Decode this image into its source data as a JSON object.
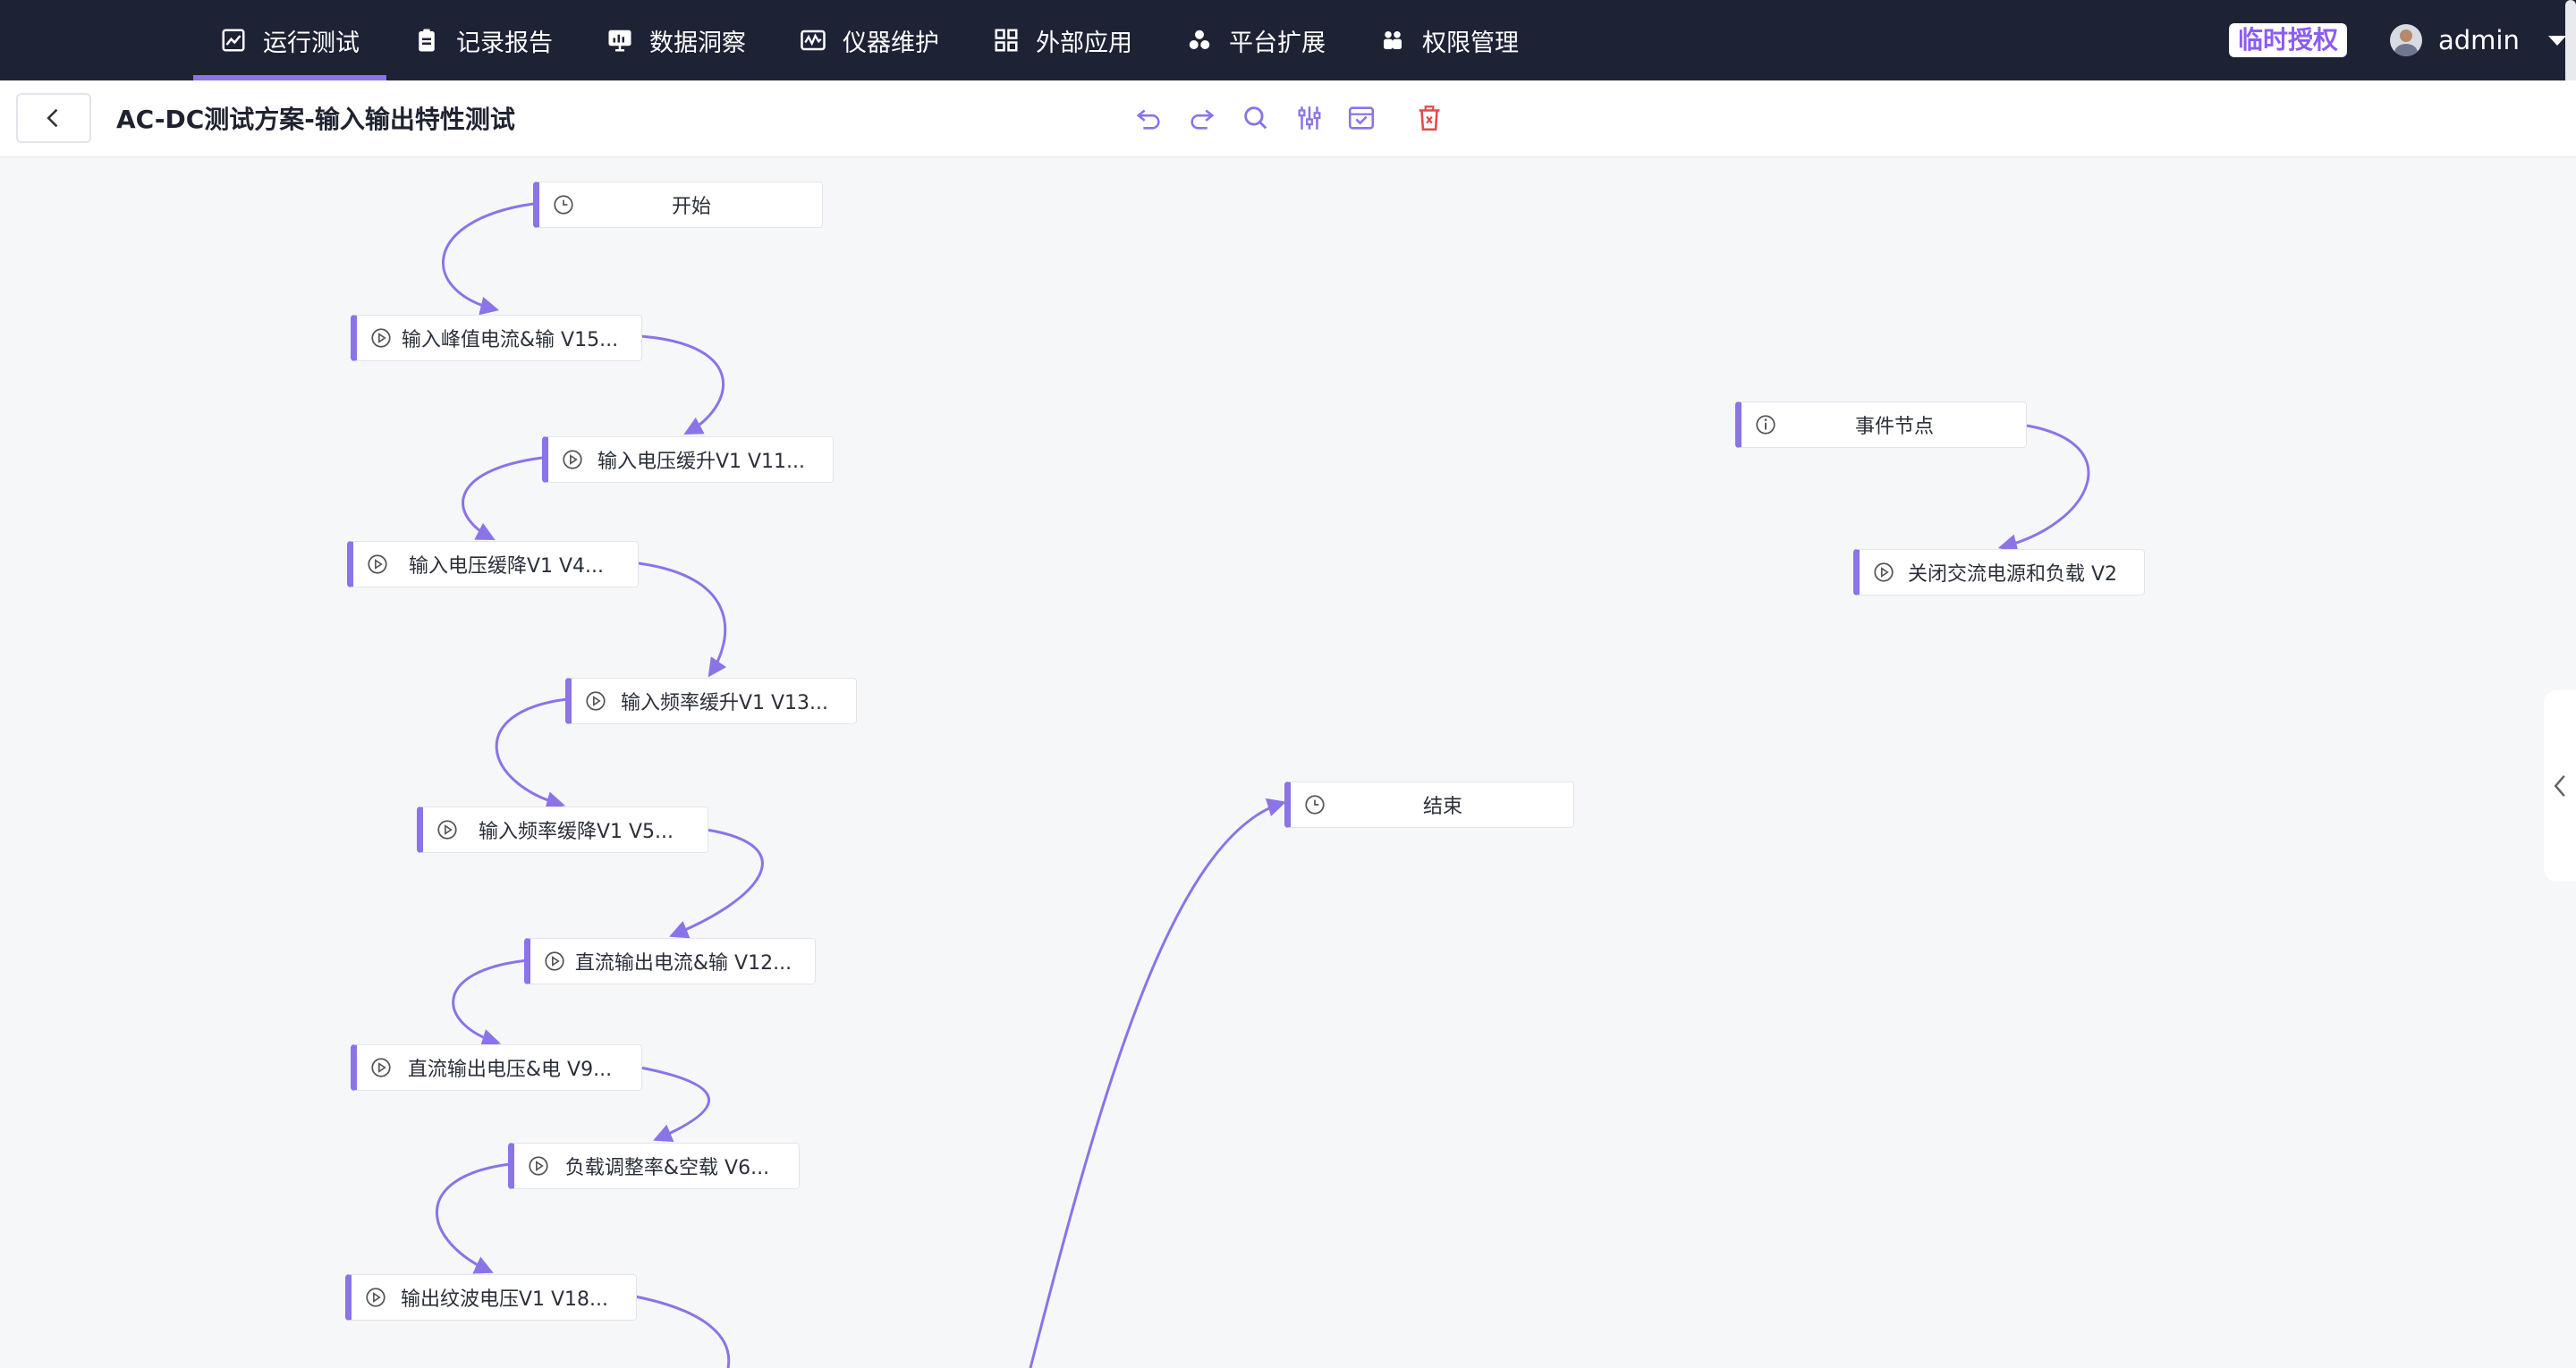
{
  "nav": {
    "items": [
      {
        "label": "运行测试",
        "icon": "chart-icon",
        "active": true
      },
      {
        "label": "记录报告",
        "icon": "clipboard-icon"
      },
      {
        "label": "数据洞察",
        "icon": "monitor-chart-icon"
      },
      {
        "label": "仪器维护",
        "icon": "waveform-icon"
      },
      {
        "label": "外部应用",
        "icon": "grid-icon"
      },
      {
        "label": "平台扩展",
        "icon": "cluster-icon"
      },
      {
        "label": "权限管理",
        "icon": "users-icon"
      }
    ],
    "license_badge": "临时授权",
    "username": "admin"
  },
  "header": {
    "title": "AC-DC测试方案-输入输出特性测试",
    "tools": [
      "undo-icon",
      "redo-icon",
      "search-icon",
      "sliders-icon",
      "save-icon",
      "delete-icon"
    ]
  },
  "colors": {
    "accent": "#8b73e8",
    "nav_bg": "#1e2235",
    "delete": "#e5484d",
    "tool": "#8b73e8"
  },
  "nodes": [
    {
      "label": "开始",
      "icon": "clock-icon"
    },
    {
      "label": "输入峰值电流&输 V15...",
      "icon": "play-icon"
    },
    {
      "label": "输入电压缓升V1 V11...",
      "icon": "play-icon"
    },
    {
      "label": "输入电压缓降V1 V4...",
      "icon": "play-icon"
    },
    {
      "label": "输入频率缓升V1 V13...",
      "icon": "play-icon"
    },
    {
      "label": "输入频率缓降V1 V5...",
      "icon": "play-icon"
    },
    {
      "label": "直流输出电流&输 V12...",
      "icon": "play-icon"
    },
    {
      "label": "直流输出电压&电 V9...",
      "icon": "play-icon"
    },
    {
      "label": "负载调整率&空载 V6...",
      "icon": "play-icon"
    },
    {
      "label": "输出纹波电压V1 V18...",
      "icon": "play-icon"
    },
    {
      "label": "事件节点",
      "icon": "info-icon"
    },
    {
      "label": "关闭交流电源和负载 V2",
      "icon": "play-icon"
    },
    {
      "label": "结束",
      "icon": "clock-icon"
    }
  ]
}
